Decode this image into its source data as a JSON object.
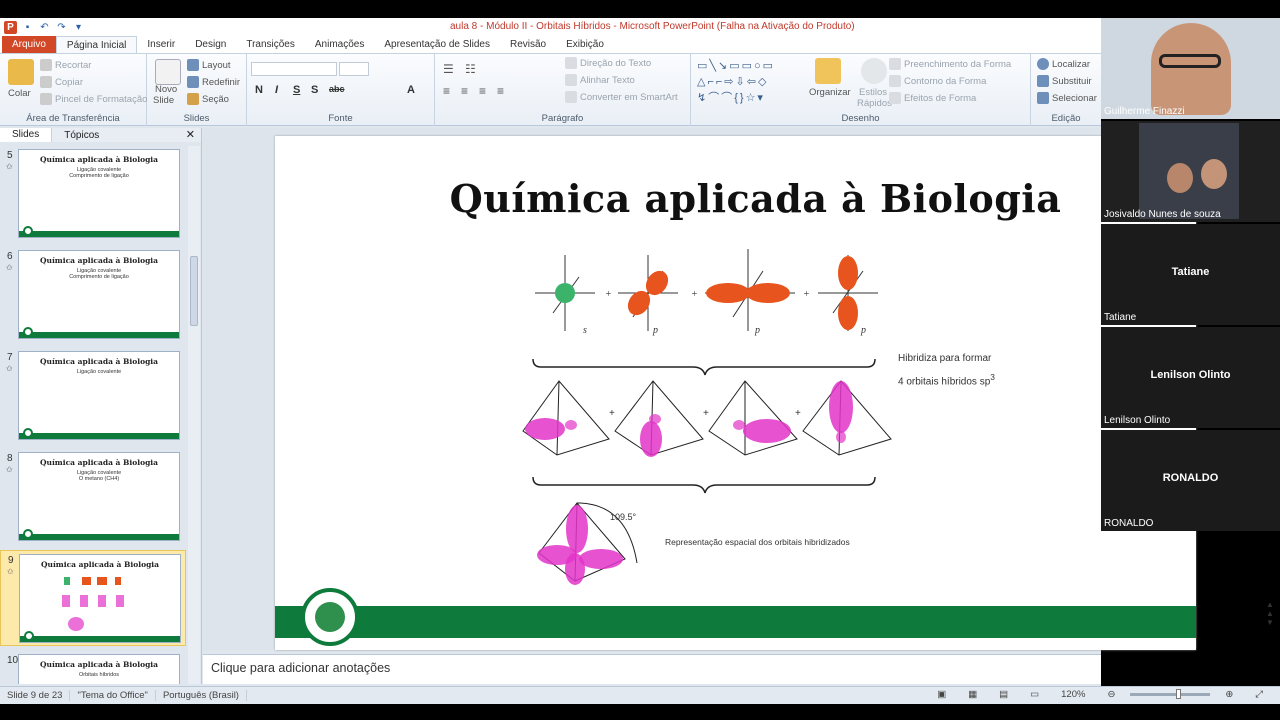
{
  "window": {
    "title": "aula 8 - Módulo II - Orbitais Híbridos - Microsoft PowerPoint (Falha na Ativação do Produto)"
  },
  "ribbon_tabs": [
    {
      "label": "Arquivo"
    },
    {
      "label": "Página Inicial"
    },
    {
      "label": "Inserir"
    },
    {
      "label": "Design"
    },
    {
      "label": "Transições"
    },
    {
      "label": "Animações"
    },
    {
      "label": "Apresentação de Slides"
    },
    {
      "label": "Revisão"
    },
    {
      "label": "Exibição"
    }
  ],
  "ribbon": {
    "clipboard": {
      "paste": "Colar",
      "cut": "Recortar",
      "copy": "Copiar",
      "format_painter": "Pincel de Formatação",
      "label": "Área de Transferência"
    },
    "slides": {
      "new_slide": "Novo",
      "new_slide2": "Slide",
      "layout": "Layout",
      "reset": "Redefinir",
      "section": "Seção",
      "label": "Slides"
    },
    "font": {
      "label": "Fonte"
    },
    "paragraph": {
      "text_direction": "Direção do Texto",
      "align_text": "Alinhar Texto",
      "smartart": "Converter em SmartArt",
      "label": "Parágrafo"
    },
    "drawing": {
      "arrange": "Organizar",
      "quick_styles": "Estilos",
      "quick_styles2": "Rápidos",
      "shape_fill": "Preenchimento da Forma",
      "shape_outline": "Contorno da Forma",
      "shape_effects": "Efeitos de Forma",
      "label": "Desenho"
    },
    "editing": {
      "find": "Localizar",
      "replace": "Substituir",
      "select": "Selecionar",
      "label": "Edição"
    }
  },
  "panel": {
    "tabs": [
      "Slides",
      "Tópicos"
    ],
    "thumbnails": [
      {
        "num": "5",
        "title": "Química aplicada à Biologia",
        "sub": "Ligação covalente\nComprimento de ligação"
      },
      {
        "num": "6",
        "title": "Química aplicada à Biologia",
        "sub": "Ligação covalente\nComprimento de ligação"
      },
      {
        "num": "7",
        "title": "Química aplicada à Biologia",
        "sub": "Ligação covalente"
      },
      {
        "num": "8",
        "title": "Química aplicada à Biologia",
        "sub": "Ligação covalente\nO metano (CH4)"
      },
      {
        "num": "9",
        "title": "Química aplicada à Biologia",
        "sub": ""
      },
      {
        "num": "10",
        "title": "Química aplicada à Biologia",
        "sub": "Orbitais híbridos"
      }
    ]
  },
  "slide": {
    "title": "Química aplicada à Biologia",
    "caption_line1": "Hibridiza para formar",
    "caption_line2": "4 orbitais híbridos sp",
    "caption_sup": "3",
    "caption_spatial": "Representação espacial dos orbitais hibridizados",
    "angle": "109.5°"
  },
  "notes": {
    "placeholder": "Clique para adicionar anotações"
  },
  "status": {
    "slide": "Slide 9 de 23",
    "theme": "\"Tema do Office\"",
    "language": "Português (Brasil)",
    "zoom": "120%"
  },
  "participants": [
    {
      "name": "Guilherme Finazzi",
      "has_video": true
    },
    {
      "name": "Josivaldo Nunes de souza",
      "has_video": true
    },
    {
      "name": "Tatiane",
      "has_video": false
    },
    {
      "name": "Lenilson Olinto",
      "has_video": false
    },
    {
      "name": "RONALDO",
      "has_video": false
    }
  ],
  "colors": {
    "brand_green": "#0e7a3b",
    "file_tab": "#d24726",
    "orbital_orange": "#e8541d",
    "orbital_pink": "#e234c8"
  }
}
